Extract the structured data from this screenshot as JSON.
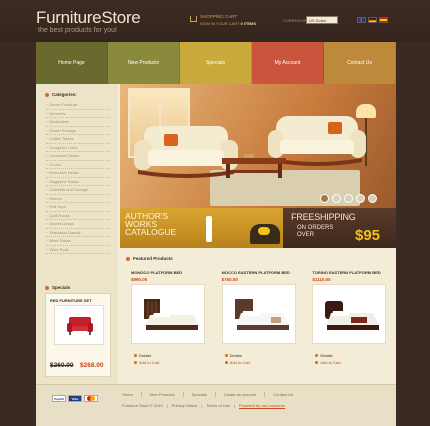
{
  "header": {
    "logo": "FurnitureStore",
    "slogan": "the best products for you!",
    "cart_title": "SHOPPING CART",
    "cart_info_prefix": "NOW IN YOUR CART",
    "cart_info_items": "0 ITEMS",
    "currencies_label": "CURRENCIES",
    "currency_selected": "US Dollar",
    "languages": [
      "English",
      "Deutsch",
      "Español"
    ]
  },
  "nav": {
    "items": [
      {
        "label": "Home Page",
        "color": "#6b6a2e"
      },
      {
        "label": "New Products",
        "color": "#8a8a3c"
      },
      {
        "label": "Specials",
        "color": "#c9a83c"
      },
      {
        "label": "My Account",
        "color": "#c9553c"
      },
      {
        "label": "Contact Us",
        "color": "#bd8a3c"
      }
    ]
  },
  "sidebar": {
    "categories_title": "Categories:",
    "categories": [
      "Home Furniture",
      "Armoires",
      "Bookcases",
      "Closet Storage",
      "Coffee Tables",
      "Computer Carts",
      "Computer Desks",
      "Curios",
      "Executive Desks",
      "Magazine Racks",
      "Cabinets and Storage",
      "Mirrors",
      "Roll Tops",
      "Quilt Racks",
      "Sauna Lamps",
      "Television Stands",
      "Wine Racks",
      "Wine Pods"
    ],
    "specials_title": "Specials",
    "special": {
      "name": "RED FURNITURE SET",
      "old_price": "$260.00",
      "new_price": "$268.00"
    }
  },
  "banners": {
    "author_line1": "AUTHOR'S",
    "author_line2": "WORKS",
    "author_line3": "CATALOGUE",
    "free_shipping": "FREESHIPPING",
    "on_orders": "ON ORDERS",
    "over": "OVER",
    "amount": "$95"
  },
  "featured": {
    "title": "Featured Products",
    "products": [
      {
        "name": "MONOCO PLATFORM BED",
        "price": "$990.00",
        "details": "Details",
        "add_to_cart": "Add to Cart"
      },
      {
        "name": "MOCCO EASTERN PLATFORM BED",
        "price": "$750.50",
        "details": "Details",
        "add_to_cart": "Add to Cart"
      },
      {
        "name": "TORINO EASTERN PLATFORM BED",
        "price": "$1110.00",
        "details": "Details",
        "add_to_cart": "Add to Cart"
      }
    ]
  },
  "footer": {
    "payment": [
      "PayPal",
      "VISA",
      "MasterCard"
    ],
    "links": [
      "Home",
      "New Products",
      "Specials",
      "Create an account",
      "Contact Us"
    ],
    "copyright": "Furniture Store © 2010",
    "privacy": "Privacy Notice",
    "terms": "Terms of Use",
    "powered": "Powered by osCommerce"
  },
  "colors": {
    "accent": "#c94a1a",
    "background": "#3a2a22",
    "content": "#f3ecd6"
  }
}
